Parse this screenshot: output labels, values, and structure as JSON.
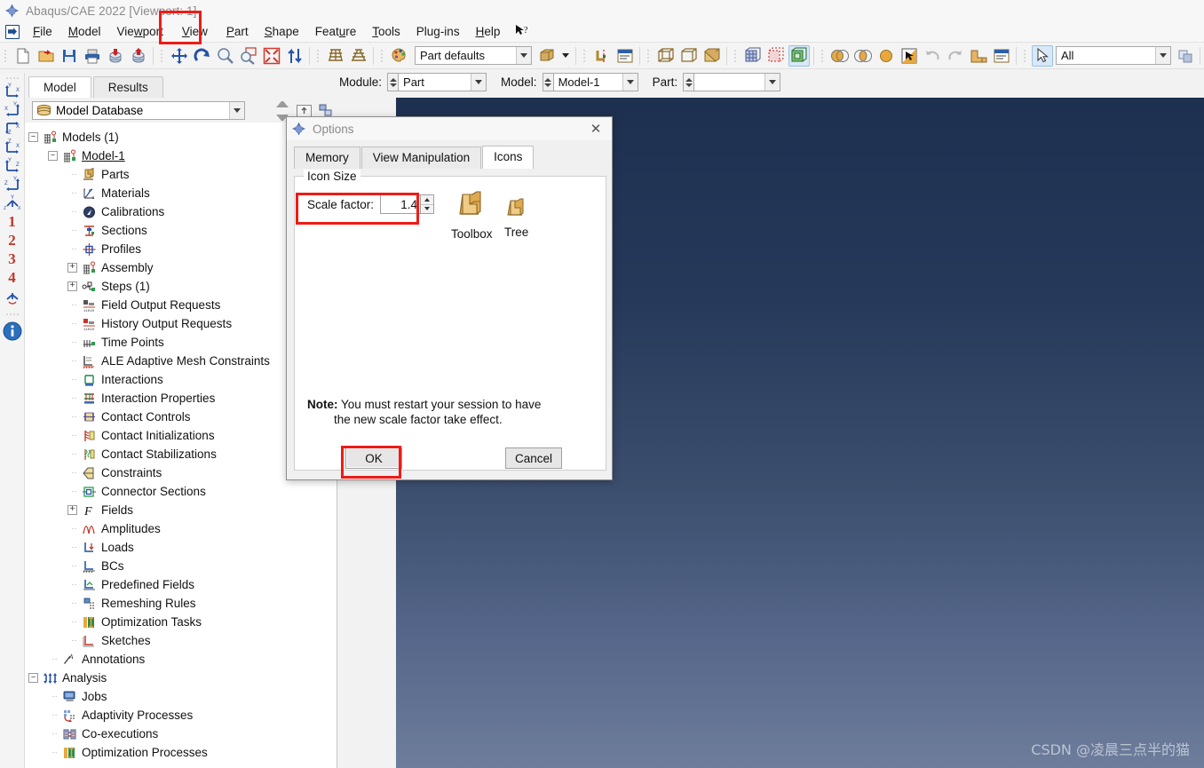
{
  "window": {
    "title": "Abaqus/CAE 2022 [Viewport: 1]",
    "app_icon": "abaqus-logo-icon"
  },
  "menubar": {
    "items": [
      {
        "label": "File",
        "mnemonic": "F"
      },
      {
        "label": "Model",
        "mnemonic": "M"
      },
      {
        "label": "Viewport",
        "mnemonic": "w"
      },
      {
        "label": "View",
        "mnemonic": "V"
      },
      {
        "label": "Part",
        "mnemonic": "P"
      },
      {
        "label": "Shape",
        "mnemonic": "S"
      },
      {
        "label": "Feature",
        "mnemonic": "u"
      },
      {
        "label": "Tools",
        "mnemonic": "T"
      },
      {
        "label": "Plug-ins",
        "mnemonic": "g"
      },
      {
        "label": "Help",
        "mnemonic": "H"
      }
    ],
    "context_help": "↖?"
  },
  "toolbar": {
    "render_style_value": "Part defaults",
    "selection_filter_value": "All",
    "icons": [
      "new-file-icon",
      "open-file-icon",
      "save-model-database-icon",
      "print-icon",
      "import-model-icon",
      "export-model-icon",
      "pan-view-icon",
      "rotate-view-icon",
      "zoom-in-icon",
      "zoom-box-icon",
      "auto-fit-view-icon",
      "resize-icon",
      "perspective-icon",
      "parallel-icon",
      "color-palette-icon",
      "render-beam-profiles-icon",
      "viewport-annotations-icon",
      "datum-icon",
      "viewport-layers-icon",
      "wireframe-icon",
      "hidden-line-icon",
      "shaded-icon",
      "mesh-visible-icon",
      "mesh-dashed-icon",
      "mesh-shaded-icon",
      "render-overlay-1-icon",
      "render-overlay-2-icon",
      "render-overlay-3-icon",
      "render-overlay-4-icon",
      "highlight-icon",
      "undo-icon",
      "redo-icon",
      "part-display-icon",
      "annotation-icon",
      "select-arrow-icon",
      "replace-selection-icon",
      "display-group-icon",
      "create-set-icon",
      "create-display-group-icon",
      "query-icon"
    ]
  },
  "left_toolbar": {
    "items": [
      {
        "name": "view-xy-icon",
        "label": ""
      },
      {
        "name": "view-yx-icon",
        "label": ""
      },
      {
        "name": "view-zx-icon",
        "label": ""
      },
      {
        "name": "view-zx2-icon",
        "label": ""
      },
      {
        "name": "view-yz-icon",
        "label": ""
      },
      {
        "name": "view-zy-icon",
        "label": ""
      },
      {
        "name": "view-iso-icon",
        "label": ""
      },
      {
        "name": "saved-view-1",
        "label": "1"
      },
      {
        "name": "saved-view-2",
        "label": "2"
      },
      {
        "name": "saved-view-3",
        "label": "3"
      },
      {
        "name": "saved-view-4",
        "label": "4"
      },
      {
        "name": "view-axes-icon",
        "label": ""
      },
      {
        "name": "info-icon",
        "label": "i"
      }
    ]
  },
  "module_bar": {
    "module_label": "Module:",
    "module_value": "Part",
    "model_label": "Model:",
    "model_value": "Model-1",
    "part_label": "Part:",
    "part_value": ""
  },
  "model_panel": {
    "tabs": [
      {
        "label": "Model",
        "active": true
      },
      {
        "label": "Results",
        "active": false
      }
    ],
    "database_selector": "Model Database",
    "tree": [
      {
        "label": "Models (1)",
        "indent": 0,
        "expander": "-",
        "icon": "models-icon"
      },
      {
        "label": "Model-1",
        "indent": 1,
        "expander": "-",
        "icon": "model-icon",
        "underline": true
      },
      {
        "label": "Parts",
        "indent": 2,
        "expander": "dot",
        "icon": "parts-icon"
      },
      {
        "label": "Materials",
        "indent": 2,
        "expander": "dot",
        "icon": "materials-icon"
      },
      {
        "label": "Calibrations",
        "indent": 2,
        "expander": "dot",
        "icon": "calibrations-icon"
      },
      {
        "label": "Sections",
        "indent": 2,
        "expander": "dot",
        "icon": "sections-icon"
      },
      {
        "label": "Profiles",
        "indent": 2,
        "expander": "dot",
        "icon": "profiles-icon"
      },
      {
        "label": "Assembly",
        "indent": 2,
        "expander": "+",
        "icon": "assembly-icon"
      },
      {
        "label": "Steps (1)",
        "indent": 2,
        "expander": "+",
        "icon": "steps-icon"
      },
      {
        "label": "Field Output Requests",
        "indent": 2,
        "expander": "dot",
        "icon": "field-output-icon"
      },
      {
        "label": "History Output Requests",
        "indent": 2,
        "expander": "dot",
        "icon": "history-output-icon"
      },
      {
        "label": "Time Points",
        "indent": 2,
        "expander": "dot",
        "icon": "time-points-icon"
      },
      {
        "label": "ALE Adaptive Mesh Constraints",
        "indent": 2,
        "expander": "dot",
        "icon": "ale-adaptive-icon"
      },
      {
        "label": "Interactions",
        "indent": 2,
        "expander": "dot",
        "icon": "interactions-icon"
      },
      {
        "label": "Interaction Properties",
        "indent": 2,
        "expander": "dot",
        "icon": "interaction-properties-icon"
      },
      {
        "label": "Contact Controls",
        "indent": 2,
        "expander": "dot",
        "icon": "contact-controls-icon"
      },
      {
        "label": "Contact Initializations",
        "indent": 2,
        "expander": "dot",
        "icon": "contact-initializations-icon"
      },
      {
        "label": "Contact Stabilizations",
        "indent": 2,
        "expander": "dot",
        "icon": "contact-stabilizations-icon"
      },
      {
        "label": "Constraints",
        "indent": 2,
        "expander": "dot",
        "icon": "constraints-icon"
      },
      {
        "label": "Connector Sections",
        "indent": 2,
        "expander": "dot",
        "icon": "connector-sections-icon"
      },
      {
        "label": "Fields",
        "indent": 2,
        "expander": "+",
        "icon": "fields-icon"
      },
      {
        "label": "Amplitudes",
        "indent": 2,
        "expander": "dot",
        "icon": "amplitudes-icon"
      },
      {
        "label": "Loads",
        "indent": 2,
        "expander": "dot",
        "icon": "loads-icon"
      },
      {
        "label": "BCs",
        "indent": 2,
        "expander": "dot",
        "icon": "bcs-icon"
      },
      {
        "label": "Predefined Fields",
        "indent": 2,
        "expander": "dot",
        "icon": "predefined-fields-icon"
      },
      {
        "label": "Remeshing Rules",
        "indent": 2,
        "expander": "dot",
        "icon": "remeshing-rules-icon"
      },
      {
        "label": "Optimization Tasks",
        "indent": 2,
        "expander": "dot",
        "icon": "optimization-tasks-icon"
      },
      {
        "label": "Sketches",
        "indent": 2,
        "expander": "dot",
        "icon": "sketches-icon"
      },
      {
        "label": "Annotations",
        "indent": 1,
        "expander": "dot",
        "icon": "annotations-icon"
      },
      {
        "label": "Analysis",
        "indent": 0,
        "expander": "-",
        "icon": "analysis-icon"
      },
      {
        "label": "Jobs",
        "indent": 1,
        "expander": "dot",
        "icon": "jobs-icon"
      },
      {
        "label": "Adaptivity Processes",
        "indent": 1,
        "expander": "dot",
        "icon": "adaptivity-processes-icon"
      },
      {
        "label": "Co-executions",
        "indent": 1,
        "expander": "dot",
        "icon": "co-executions-icon"
      },
      {
        "label": "Optimization Processes",
        "indent": 1,
        "expander": "dot",
        "icon": "optimization-processes-icon"
      }
    ]
  },
  "dialog": {
    "title": "Options",
    "close_label": "✕",
    "tabs": [
      {
        "label": "Memory",
        "active": false
      },
      {
        "label": "View Manipulation",
        "active": false
      },
      {
        "label": "Icons",
        "active": true
      }
    ],
    "group_title": "Icon Size",
    "scale_factor_label": "Scale factor:",
    "scale_factor_value": "1.4",
    "sample_toolbox_caption": "Toolbox",
    "sample_tree_caption": "Tree",
    "note_prefix": "Note:",
    "note_line1": "You must restart your session to have",
    "note_line2": "the new scale factor take effect.",
    "ok_label": "OK",
    "cancel_label": "Cancel"
  },
  "viewport": {
    "watermark": "CSDN @凌晨三点半的猫",
    "bg_top": "#1e3050",
    "bg_bottom": "#6e7d9b"
  },
  "annotations": {
    "highlight_color": "#ef1b16",
    "boxes": [
      "view-menu-highlight",
      "scale-factor-highlight",
      "ok-button-highlight"
    ]
  }
}
